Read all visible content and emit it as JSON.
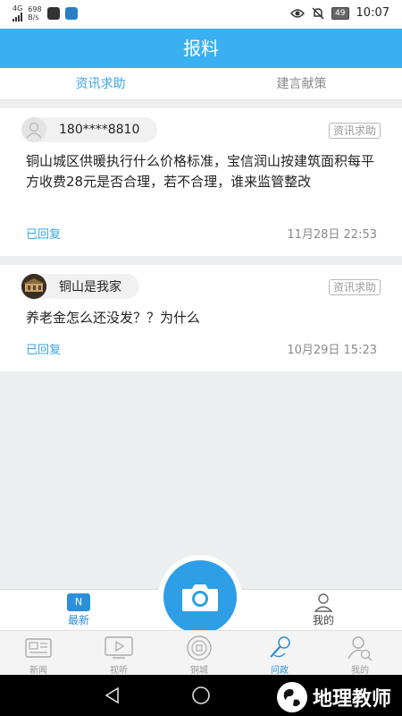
{
  "status_bar": {
    "network": "4G",
    "speed_value": "698",
    "speed_unit": "B/s",
    "battery": "49",
    "time": "10:07"
  },
  "header": {
    "title": "报料"
  },
  "tabs": [
    {
      "label": "资讯求助",
      "active": true
    },
    {
      "label": "建言献策",
      "active": false
    }
  ],
  "posts": [
    {
      "user": "180****8810",
      "tag": "资讯求助",
      "content": "铜山城区供暖执行什么价格标准，宝信润山按建筑面积每平方收费28元是否合理，若不合理，谁来监管整改",
      "status": "已回复",
      "date": "11月28日 22:53"
    },
    {
      "user": "铜山是我家",
      "tag": "资讯求助",
      "content": "养老金怎么还没发？？为什么",
      "status": "已回复",
      "date": "10月29日 15:23"
    }
  ],
  "bottom_tabs": {
    "latest": {
      "label": "最新",
      "icon_text": "N"
    },
    "mine": {
      "label": "我的"
    }
  },
  "app_nav": [
    {
      "label": "新闻",
      "icon": "newspaper-icon"
    },
    {
      "label": "视听",
      "icon": "video-icon"
    },
    {
      "label": "铜城",
      "icon": "city-icon"
    },
    {
      "label": "问政",
      "icon": "microphone-icon",
      "active": true
    },
    {
      "label": "我的",
      "icon": "user-search-icon"
    }
  ],
  "watermark": {
    "text": "地理教师"
  },
  "colors": {
    "accent": "#3bb0f0",
    "active_tab": "#3ba6e6",
    "camera": "#2e9ee6"
  }
}
